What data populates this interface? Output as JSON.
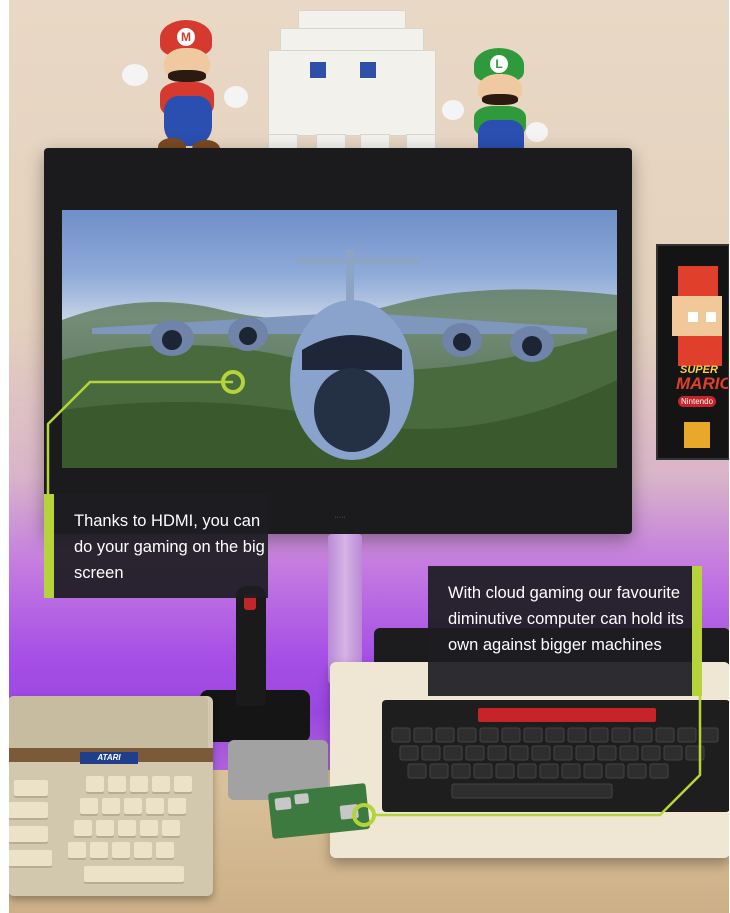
{
  "callouts": {
    "hdmi": "Thanks to HDMI, you can do your gaming on the big screen",
    "cloud": "With cloud gaming our favourite diminutive computer can hold its own against bigger machines"
  },
  "objects": {
    "atari_badge": "ATARI",
    "mario_emblem": "M",
    "luigi_emblem": "L",
    "poster_lines": [
      "SUPER",
      "MARIO",
      "Nintendo"
    ]
  },
  "colors": {
    "callout_accent": "#b6d33b",
    "callout_bg": "#1c1c22",
    "wall_glow": "#a64fe6"
  },
  "icons": {
    "callout_marker": "circle-marker-icon"
  }
}
